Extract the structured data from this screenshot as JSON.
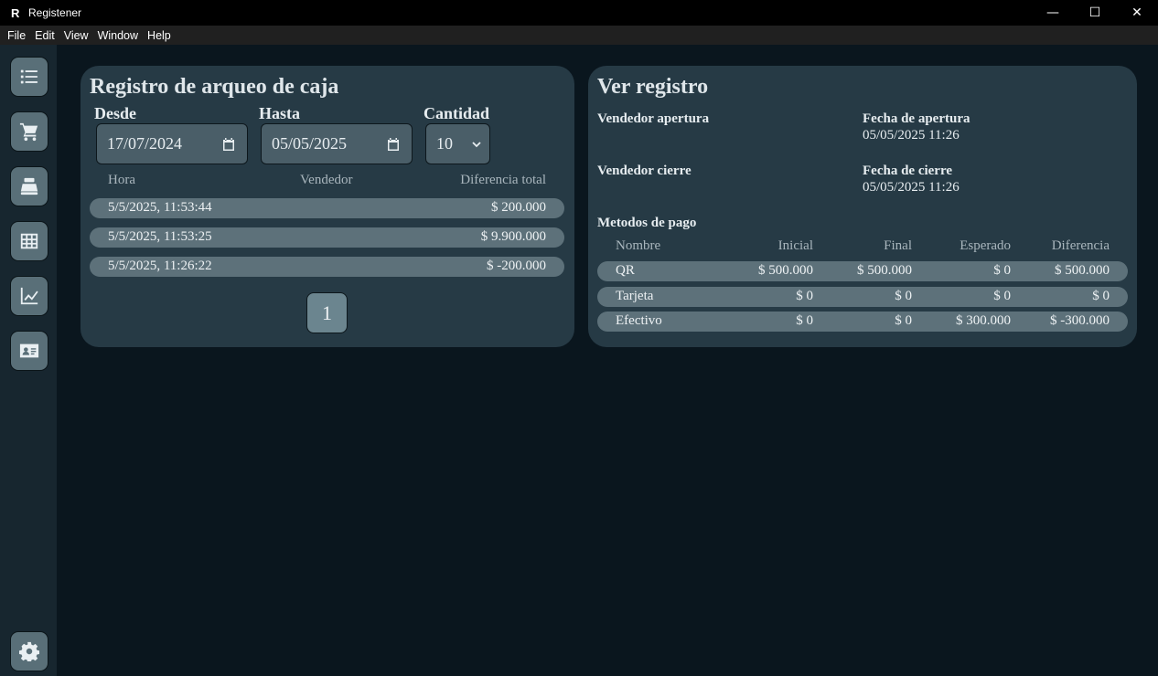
{
  "window": {
    "title": "Registener",
    "logo": "R",
    "minimize": "—",
    "maximize": "☐",
    "close": "✕"
  },
  "menu": [
    "File",
    "Edit",
    "View",
    "Window",
    "Help"
  ],
  "sidebar": {
    "items": [
      {
        "name": "list-icon"
      },
      {
        "name": "cart-icon"
      },
      {
        "name": "cash-register-icon"
      },
      {
        "name": "grid-icon"
      },
      {
        "name": "chart-line-icon"
      },
      {
        "name": "id-card-icon"
      },
      {
        "name": "gear-icon"
      }
    ]
  },
  "left": {
    "title": "Registro de arqueo de caja",
    "desde": {
      "label": "Desde",
      "value": "17/07/2024"
    },
    "hasta": {
      "label": "Hasta",
      "value": "05/05/2025"
    },
    "cantidad": {
      "label": "Cantidad",
      "value": "10"
    },
    "columns": [
      "Hora",
      "Vendedor",
      "Diferencia total"
    ],
    "rows": [
      {
        "hora": "5/5/2025, 11:53:44",
        "vendedor": "",
        "diferencia": "$ 200.000"
      },
      {
        "hora": "5/5/2025, 11:53:25",
        "vendedor": "",
        "diferencia": "$ 9.900.000"
      },
      {
        "hora": "5/5/2025, 11:26:22",
        "vendedor": "",
        "diferencia": "$ -200.000"
      }
    ],
    "page": "1"
  },
  "right": {
    "title": "Ver registro",
    "vendedor_apertura": {
      "label": "Vendedor apertura",
      "value": ""
    },
    "fecha_apertura": {
      "label": "Fecha de apertura",
      "value": "05/05/2025 11:26"
    },
    "vendedor_cierre": {
      "label": "Vendedor cierre",
      "value": ""
    },
    "fecha_cierre": {
      "label": "Fecha de cierre",
      "value": "05/05/2025 11:26"
    },
    "metodos_label": "Metodos de pago",
    "columns": [
      "Nombre",
      "Inicial",
      "Final",
      "Esperado",
      "Diferencia"
    ],
    "rows": [
      {
        "nombre": "QR",
        "inicial": "$ 500.000",
        "final": "$ 500.000",
        "esperado": "$ 0",
        "diferencia": "$ 500.000"
      },
      {
        "nombre": "Tarjeta",
        "inicial": "$ 0",
        "final": "$ 0",
        "esperado": "$ 0",
        "diferencia": "$ 0"
      },
      {
        "nombre": "Efectivo",
        "inicial": "$ 0",
        "final": "$ 0",
        "esperado": "$ 300.000",
        "diferencia": "$ -300.000"
      }
    ]
  }
}
